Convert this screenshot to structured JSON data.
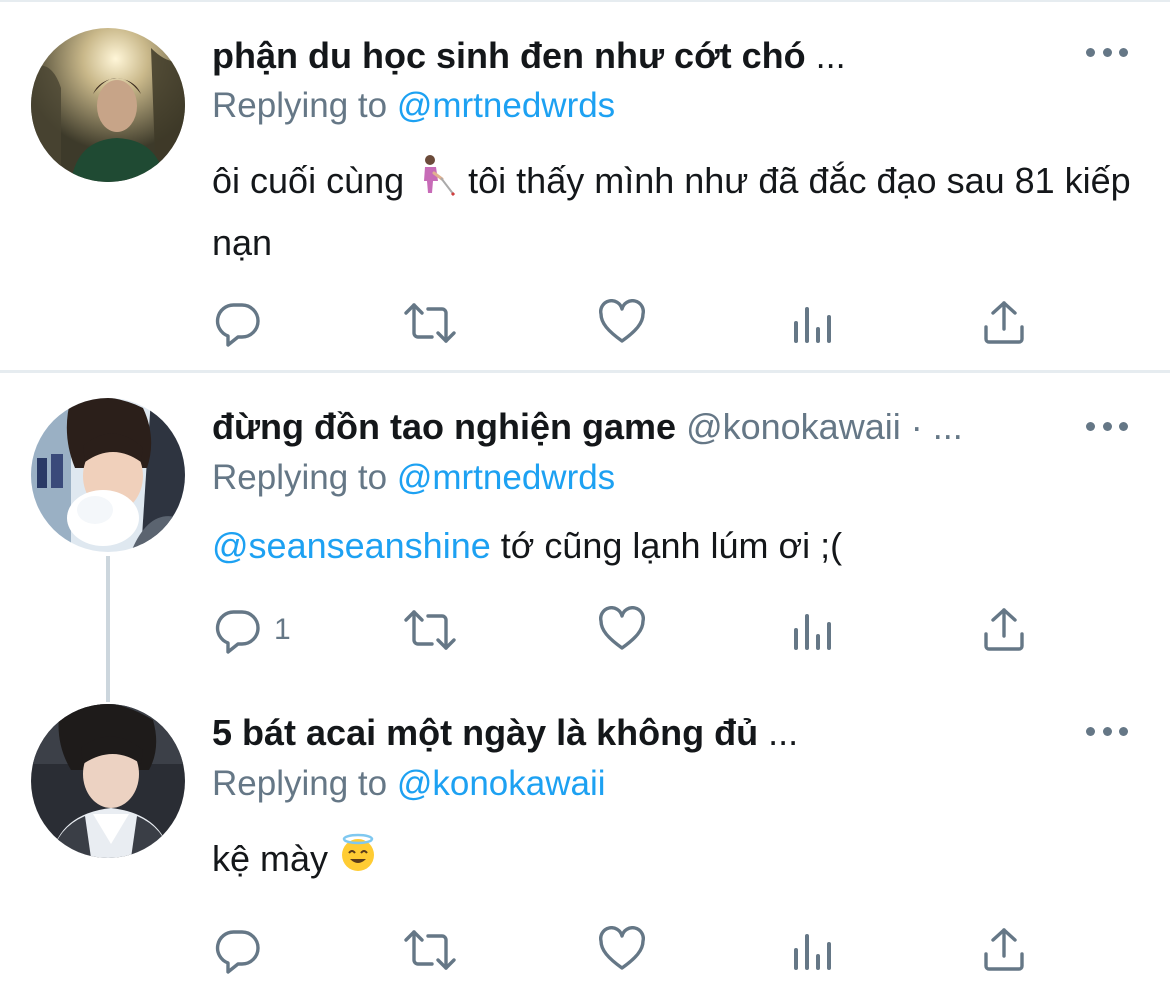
{
  "tweets": [
    {
      "display_name": "phận du học sinh đen như cớt chó",
      "handle": "",
      "ellipsis": "...",
      "replying_prefix": "Replying to ",
      "replying_to": "@mrtnedwrds",
      "body_before": "ôi cuối cùng",
      "body_emoji": "person-with-white-cane-emoji",
      "body_after": " tôi thấy mình như đã đắc đạo sau 81 kiếp nạn",
      "reply_count": "",
      "avatar": "avatar-forest-photo"
    },
    {
      "display_name": "đừng đồn tao nghiện game",
      "handle": "@konokawaii · ...",
      "ellipsis": "",
      "replying_prefix": "Replying to ",
      "replying_to": "@mrtnedwrds",
      "body_mention": "@seanseanshine",
      "body_text": " tớ cũng lạnh lúm ơi ;(",
      "reply_count": "1",
      "avatar": "avatar-snow-photo"
    },
    {
      "display_name": "5 bát acai một ngày là không đủ",
      "handle": "",
      "ellipsis": "...",
      "replying_prefix": "Replying to ",
      "replying_to": "@konokawaii",
      "body_text": "kệ mày ",
      "body_emoji": "smiling-face-with-halo-emoji",
      "reply_count": "",
      "avatar": "avatar-selfie-photo"
    }
  ],
  "icons": {
    "more": "more-horizontal-icon",
    "reply": "reply-icon",
    "retweet": "retweet-icon",
    "like": "heart-icon",
    "analytics": "analytics-icon",
    "share": "share-icon"
  },
  "colors": {
    "link": "#1da1f2",
    "secondary": "#657786",
    "divider": "#e6ecf0"
  }
}
